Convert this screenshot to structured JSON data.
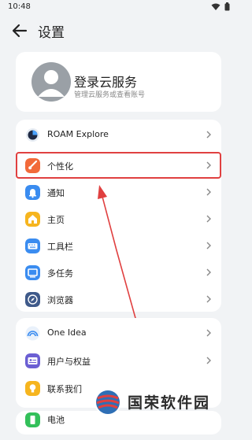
{
  "status_bar": {
    "time": "10:48"
  },
  "header": {
    "title": "设置"
  },
  "account": {
    "title": "登录云服务",
    "subtitle": "管理云服务或查看账号"
  },
  "group1": {
    "items": [
      {
        "label": "ROAM Explore",
        "icon": "roam-icon"
      },
      {
        "label": "个性化",
        "icon": "brush-icon"
      },
      {
        "label": "通知",
        "icon": "bell-icon"
      },
      {
        "label": "主页",
        "icon": "home-icon"
      },
      {
        "label": "工具栏",
        "icon": "keyboard-icon"
      },
      {
        "label": "多任务",
        "icon": "multitask-icon"
      },
      {
        "label": "浏览器",
        "icon": "compass-icon"
      }
    ]
  },
  "group2": {
    "items": [
      {
        "label": "One Idea",
        "icon": "rainbow-icon"
      },
      {
        "label": "用户与权益",
        "icon": "id-card-icon"
      },
      {
        "label": "联系我们",
        "icon": "bulb-icon"
      }
    ]
  },
  "group3": {
    "items": [
      {
        "label": "电池",
        "icon": "battery-icon"
      }
    ]
  },
  "watermark": {
    "text": "国荣软件园"
  },
  "colors": {
    "highlight": "#e04040",
    "blue": "#3a8cf0",
    "orange": "#f26a3a",
    "yellow": "#f6b51f",
    "green": "#33c05a"
  }
}
